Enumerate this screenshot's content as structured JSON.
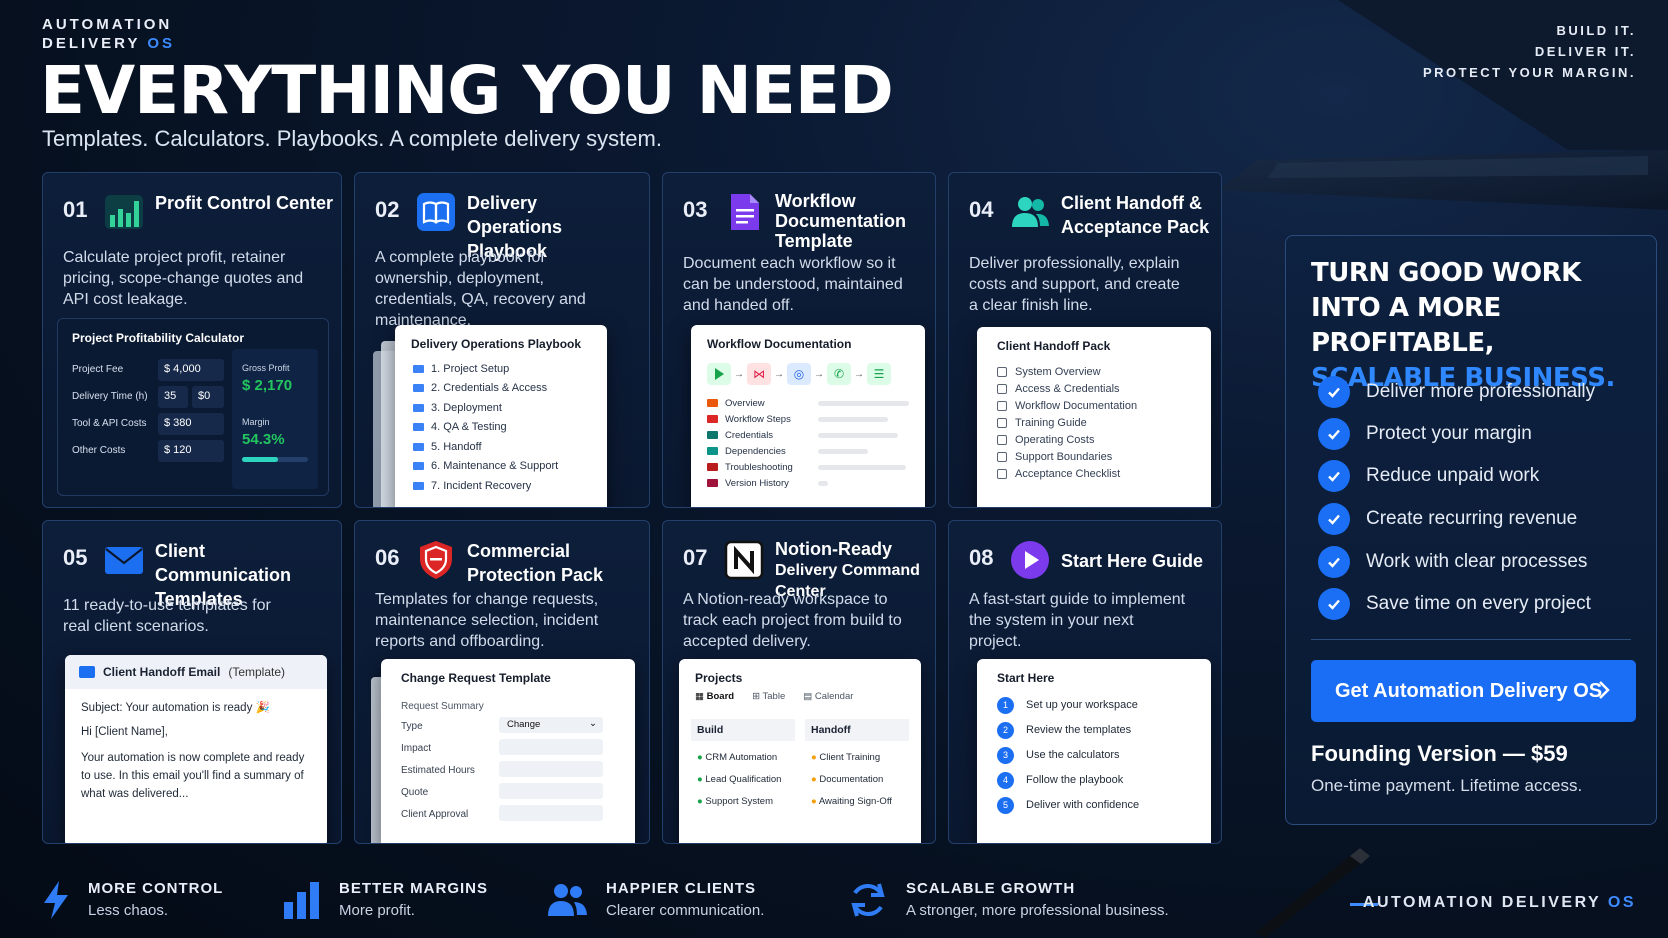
{
  "brand": {
    "line1": "AUTOMATION",
    "line2": "DELIVERY",
    "os": "OS"
  },
  "headline": "EVERYTHING YOU NEED",
  "subline": "Templates. Calculators. Playbooks. A complete delivery system.",
  "tagline": [
    "BUILD IT.",
    "DELIVER IT.",
    "PROTECT YOUR MARGIN."
  ],
  "cards": [
    {
      "num": "01",
      "icon": "bar-chart-icon",
      "title": "Profit Control Center",
      "desc": "Calculate project profit, retainer pricing, scope-change quotes and API cost leakage.",
      "preview": {
        "title": "Project Profitability Calculator",
        "rows": [
          {
            "label": "Project Fee",
            "value": "$ 4,000"
          },
          {
            "label": "Delivery Time (h)",
            "value": "35",
            "extra": "$0"
          },
          {
            "label": "Tool & API Costs",
            "value": "$ 380"
          },
          {
            "label": "Other Costs",
            "value": "$ 120"
          }
        ],
        "gross_label": "Gross Profit",
        "gross_value": "$ 2,170",
        "margin_label": "Margin",
        "margin_value": "54.3%",
        "margin_fraction": 0.543
      }
    },
    {
      "num": "02",
      "icon": "book-icon",
      "title": "Delivery Operations Playbook",
      "desc": "A complete playbook for ownership, deployment, credentials, QA, recovery and maintenance.",
      "preview": {
        "title": "Delivery Operations Playbook",
        "items": [
          "1. Project Setup",
          "2. Credentials & Access",
          "3. Deployment",
          "4. QA & Testing",
          "5. Handoff",
          "6. Maintenance & Support",
          "7. Incident Recovery"
        ]
      }
    },
    {
      "num": "03",
      "icon": "document-icon",
      "title": "Workflow Documentation Template",
      "desc": "Document each workflow so it can be understood, maintained and handed off.",
      "preview": {
        "title": "Workflow Documentation",
        "items": [
          "Overview",
          "Workflow Steps",
          "Credentials",
          "Dependencies",
          "Troubleshooting",
          "Version History"
        ]
      }
    },
    {
      "num": "04",
      "icon": "users-icon",
      "title": "Client Handoff & Acceptance Pack",
      "desc": "Deliver professionally, explain costs and support, and create a clear finish line.",
      "preview": {
        "title": "Client Handoff Pack",
        "items": [
          "System Overview",
          "Access & Credentials",
          "Workflow Documentation",
          "Training Guide",
          "Operating Costs",
          "Support Boundaries",
          "Acceptance Checklist"
        ]
      }
    },
    {
      "num": "05",
      "icon": "mail-icon",
      "title": "Client Communication Templates",
      "desc": "11 ready-to-use templates for real client scenarios.",
      "preview": {
        "title": "Client Handoff Email",
        "title_suffix": "(Template)",
        "subject": "Subject: Your automation is ready 🎉",
        "greeting": "Hi [Client Name],",
        "body": "Your automation is now complete and ready to use. In this email you'll find a summary of what was delivered..."
      }
    },
    {
      "num": "06",
      "icon": "shield-icon",
      "title": "Commercial Protection Pack",
      "desc": "Templates for change requests, maintenance selection, incident reports and offboarding.",
      "preview": {
        "title": "Change Request Template",
        "section": "Request Summary",
        "fields": [
          "Type",
          "Impact",
          "Estimated Hours",
          "Quote",
          "Client Approval"
        ],
        "type_value": "Change"
      }
    },
    {
      "num": "07",
      "icon": "notion-icon",
      "title": "Notion-Ready",
      "title2": "Delivery Command Center",
      "desc": "A Notion-ready workspace to track each project from build to accepted delivery.",
      "preview": {
        "title": "Projects",
        "tabs": [
          "Board",
          "Table",
          "Calendar"
        ],
        "col1": {
          "name": "Build",
          "items": [
            "CRM Automation",
            "Lead Qualification",
            "Support System"
          ]
        },
        "col2": {
          "name": "Handoff",
          "items": [
            "Client Training",
            "Documentation",
            "Awaiting Sign-Off"
          ]
        }
      }
    },
    {
      "num": "08",
      "icon": "play-icon",
      "title": "Start Here Guide",
      "desc": "A fast-start guide to implement the system in your next project.",
      "preview": {
        "title": "Start Here",
        "items": [
          "Set up your workspace",
          "Review the templates",
          "Use the calculators",
          "Follow the playbook",
          "Deliver with confidence"
        ]
      }
    }
  ],
  "side": {
    "h1": "TURN GOOD WORK",
    "h2": "INTO A MORE PROFITABLE,",
    "h3": "SCALABLE BUSINESS.",
    "benefits": [
      "Deliver more professionally",
      "Protect your margin",
      "Reduce unpaid work",
      "Create recurring revenue",
      "Work with clear processes",
      "Save time on every project"
    ],
    "cta": "Get Automation Delivery OS",
    "price": "Founding Version — $59",
    "price_sub": "One-time payment. Lifetime access."
  },
  "footer": {
    "items": [
      {
        "icon": "lightning-icon",
        "title": "MORE CONTROL",
        "sub": "Less chaos."
      },
      {
        "icon": "bars-icon",
        "title": "BETTER MARGINS",
        "sub": "More profit."
      },
      {
        "icon": "people-icon",
        "title": "HAPPIER CLIENTS",
        "sub": "Clearer communication."
      },
      {
        "icon": "refresh-icon",
        "title": "SCALABLE GROWTH",
        "sub": "A stronger, more professional business."
      }
    ],
    "brand": "AUTOMATION DELIVERY",
    "brand_os": "OS"
  },
  "colors": {
    "accent": "#1a6df5",
    "accent_text": "#2f88ff",
    "green": "#22c55e",
    "bg": "#06101f"
  }
}
